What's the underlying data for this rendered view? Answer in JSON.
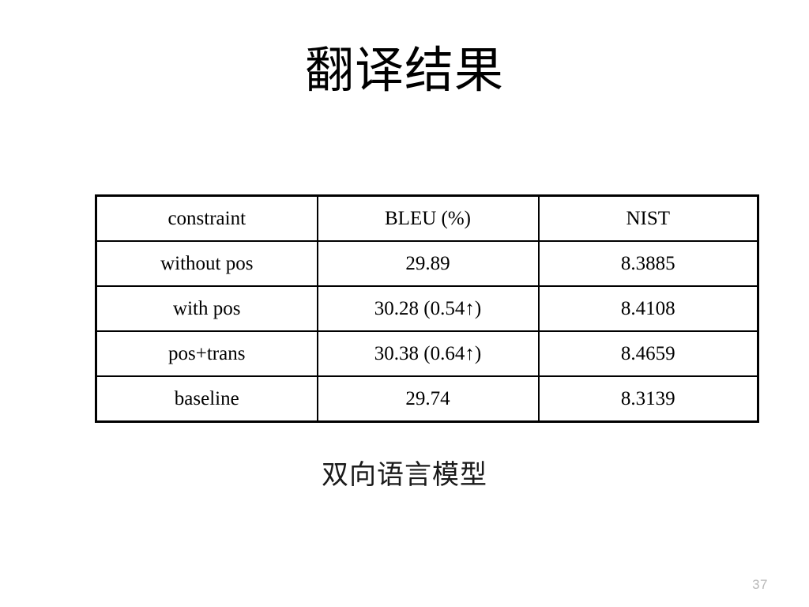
{
  "slide": {
    "title": "翻译结果",
    "caption": "双向语言模型",
    "page_number": "37",
    "accent_color": "#b31212",
    "text_color": "#000000",
    "background_color": "#ffffff"
  },
  "table": {
    "headers": {
      "constraint": "constraint",
      "bleu": "BLEU (%)",
      "nist": "NIST"
    },
    "rows": [
      {
        "constraint": "without pos",
        "bleu": "29.89",
        "nist": "8.3885",
        "bleu_highlight": false,
        "nist_bold": false
      },
      {
        "constraint": "with pos",
        "bleu": "30.28 (0.54↑)",
        "nist": "8.4108",
        "bleu_highlight": true,
        "nist_bold": false
      },
      {
        "constraint": "pos+trans",
        "bleu": "30.38 (0.64↑)",
        "nist": "8.4659",
        "bleu_highlight": true,
        "nist_bold": true
      },
      {
        "constraint": "baseline",
        "bleu": "29.74",
        "nist": "8.3139",
        "bleu_highlight": false,
        "nist_bold": false
      }
    ]
  },
  "chart_data": {
    "type": "table",
    "title": "翻译结果",
    "caption": "双向语言模型",
    "columns": [
      "constraint",
      "BLEU (%)",
      "NIST"
    ],
    "rows": [
      [
        "without pos",
        "29.89",
        "8.3885"
      ],
      [
        "with pos",
        "30.28 (0.54↑)",
        "8.4108"
      ],
      [
        "pos+trans",
        "30.38 (0.64↑)",
        "8.4659"
      ],
      [
        "baseline",
        "29.74",
        "8.3139"
      ]
    ],
    "series": [
      {
        "name": "BLEU (%)",
        "categories": [
          "without pos",
          "with pos",
          "pos+trans",
          "baseline"
        ],
        "values": [
          29.89,
          30.28,
          30.38,
          29.74
        ]
      },
      {
        "name": "NIST",
        "categories": [
          "without pos",
          "with pos",
          "pos+trans",
          "baseline"
        ],
        "values": [
          8.3885,
          8.4108,
          8.4659,
          8.3139
        ]
      }
    ],
    "annotations": [
      {
        "cell": "with pos / BLEU (%)",
        "text": "0.54↑",
        "meaning": "BLEU gain over baseline",
        "color": "#b31212"
      },
      {
        "cell": "pos+trans / BLEU (%)",
        "text": "0.64↑",
        "meaning": "BLEU gain over baseline",
        "color": "#b31212"
      },
      {
        "cell": "pos+trans / NIST",
        "text": "8.4659",
        "meaning": "best NIST score (bold)",
        "color": "#000000"
      }
    ]
  }
}
